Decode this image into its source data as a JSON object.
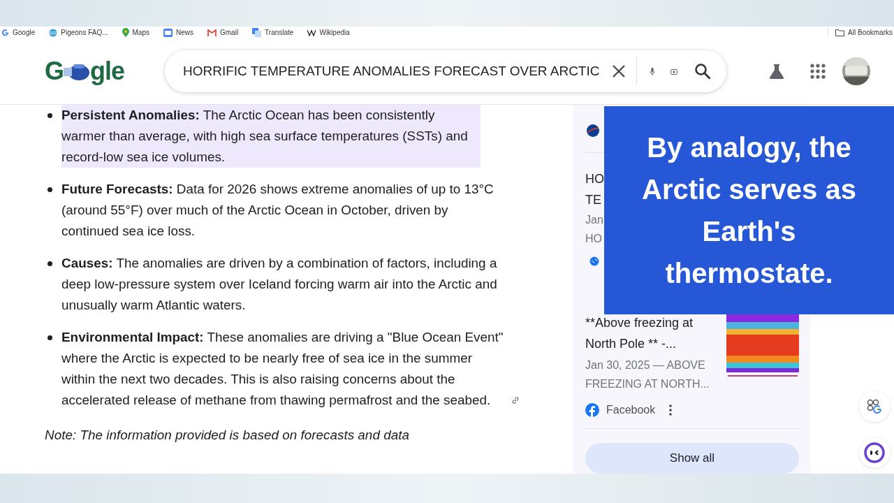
{
  "bookmarks": [
    {
      "label": "Google",
      "kind": "google"
    },
    {
      "label": "Pigeons FAQ...",
      "kind": "globe"
    },
    {
      "label": "Maps",
      "kind": "maps"
    },
    {
      "label": "News",
      "kind": "news"
    },
    {
      "label": "Gmail",
      "kind": "gmail"
    },
    {
      "label": "Translate",
      "kind": "translate"
    },
    {
      "label": "Wikipedia",
      "kind": "wiki"
    }
  ],
  "all_bookmarks": "All Bookmarks",
  "logo": {
    "left": "G",
    "right": "gle"
  },
  "search": {
    "value": "HORRIFIC TEMPERATURE ANOMALIES FORECAST OVER ARCTIC"
  },
  "bullets": [
    {
      "text": "**Persistent Anomalies:** The Arctic Ocean has been consistently warmer than average, with high sea surface temperatures (SSTs) and record-low sea ice volumes.",
      "highlighted": true,
      "link": false
    },
    {
      "text": "**Future Forecasts:** Data for 2026 shows extreme anomalies of up to 13°C (around 55°F) over much of the Arctic Ocean in October, driven by continued sea ice loss.",
      "highlighted": false,
      "link": false
    },
    {
      "text": "**Causes:** The anomalies are driven by a combination of factors, including a deep low-pressure system over Iceland forcing warm air into the Arctic and unusually warm Atlantic waters.",
      "highlighted": false,
      "link": false
    },
    {
      "text": "**Environmental Impact:** These anomalies are driving a \"Blue Ocean Event\" where the Arctic is expected to be nearly free of sea ice in the summer within the next two decades. This is also raising concerns about the accelerated release of methane from thawing permafrost and the seabed.",
      "highlighted": false,
      "link": true
    }
  ],
  "note": "Note: The information provided is based on forecasts and data",
  "side": {
    "hidden_card": {
      "lines": [
        "HO",
        "TE"
      ],
      "meta": [
        "Jan",
        "HO"
      ]
    },
    "card": {
      "title": "**Above freezing at North Pole ** -...",
      "snippet": "Jan 30, 2025 — ABOVE FREEZING AT NORTH...",
      "source": "Facebook"
    },
    "show_all": "Show all"
  },
  "caption": "By analogy, the Arctic serves as Earth's thermostate."
}
